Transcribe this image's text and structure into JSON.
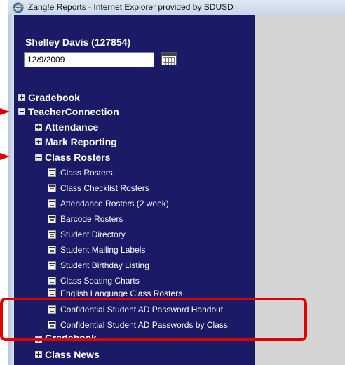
{
  "window": {
    "title": "Zang!e Reports - Internet Explorer provided by SDUSD"
  },
  "user": {
    "name": "Shelley Davis (127854)"
  },
  "date": {
    "value": "12/9/2009"
  },
  "nav": {
    "gradebook": "Gradebook",
    "teacher_connection": "TeacherConnection",
    "attendance": "Attendance",
    "mark_reporting": "Mark Reporting",
    "class_rosters": "Class Rosters",
    "reports": [
      "Class Rosters",
      "Class Checklist Rosters",
      "Attendance Rosters (2 week)",
      "Barcode Rosters",
      "Student Directory",
      "Student Mailing Labels",
      "Student Birthday Listing",
      "Class Seating Charts",
      "English Language Class Rosters",
      "Confidential Student AD Password Handout",
      "Confidential Student AD Passwords by Class"
    ],
    "gradebook_sub": "Gradebook",
    "class_news": "Class News"
  },
  "colors": {
    "nav_bg": "#1a1a66",
    "highlight": "#e00000",
    "content_bg": "#d4d4d4"
  }
}
